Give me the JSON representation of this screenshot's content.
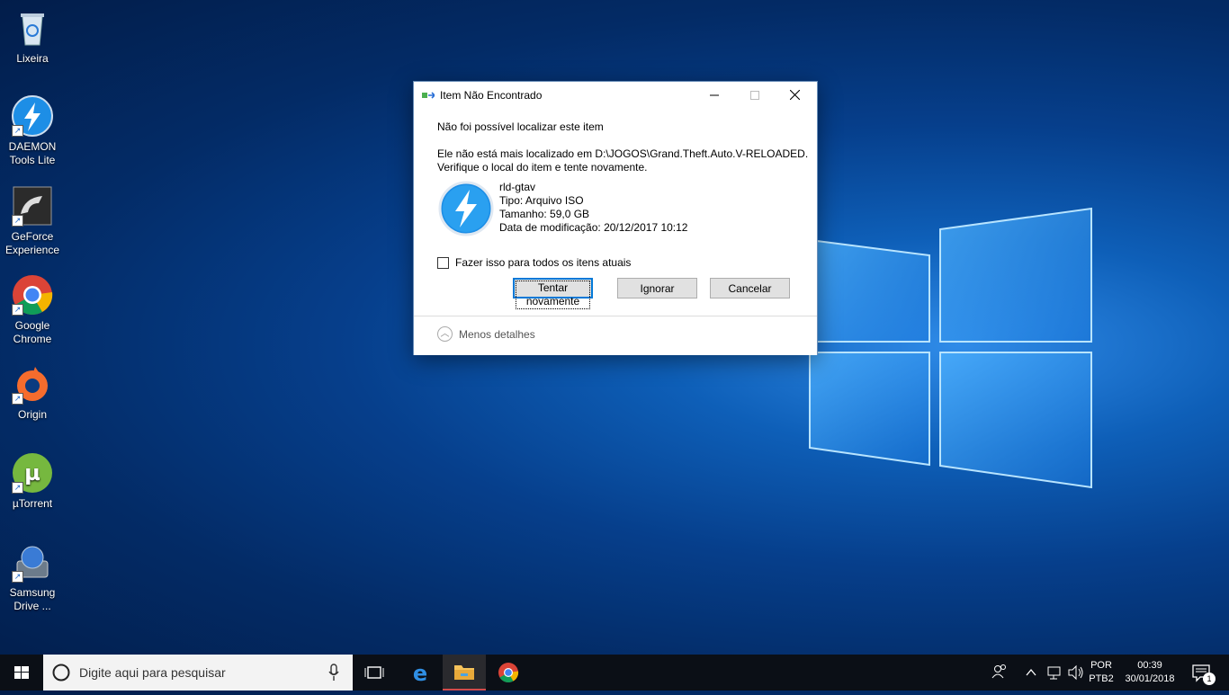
{
  "desktop": {
    "icons": [
      {
        "label_line1": "Lixeira",
        "label_line2": ""
      },
      {
        "label_line1": "DAEMON",
        "label_line2": "Tools Lite"
      },
      {
        "label_line1": "GeForce",
        "label_line2": "Experience"
      },
      {
        "label_line1": "Google",
        "label_line2": "Chrome"
      },
      {
        "label_line1": "Origin",
        "label_line2": ""
      },
      {
        "label_line1": "µTorrent",
        "label_line2": ""
      },
      {
        "label_line1": "Samsung",
        "label_line2": "Drive ..."
      }
    ]
  },
  "dialog": {
    "title": "Item Não Encontrado",
    "heading": "Não foi possível localizar este item",
    "message_line1": "Ele não está mais localizado em D:\\JOGOS\\Grand.Theft.Auto.V-RELOADED.",
    "message_line2": "Verifique o local do item e tente novamente.",
    "file": {
      "name": "rld-gtav",
      "type": "Tipo: Arquivo ISO",
      "size": "Tamanho: 59,0 GB",
      "modified": "Data de modificação: 20/12/2017 10:12"
    },
    "checkbox_label": "Fazer isso para todos os itens atuais",
    "checkbox_checked": false,
    "buttons": {
      "retry": "Tentar novamente",
      "ignore": "Ignorar",
      "cancel": "Cancelar"
    },
    "footer_link": "Menos detalhes"
  },
  "taskbar": {
    "search_placeholder": "Digite aqui para pesquisar",
    "language_line1": "POR",
    "language_line2": "PTB2",
    "time": "00:39",
    "date": "30/01/2018",
    "notification_count": "1"
  },
  "colors": {
    "accent": "#0078d7",
    "taskbar_bg": "#0b0f16",
    "active_app_indicator": "#d24b4b"
  }
}
